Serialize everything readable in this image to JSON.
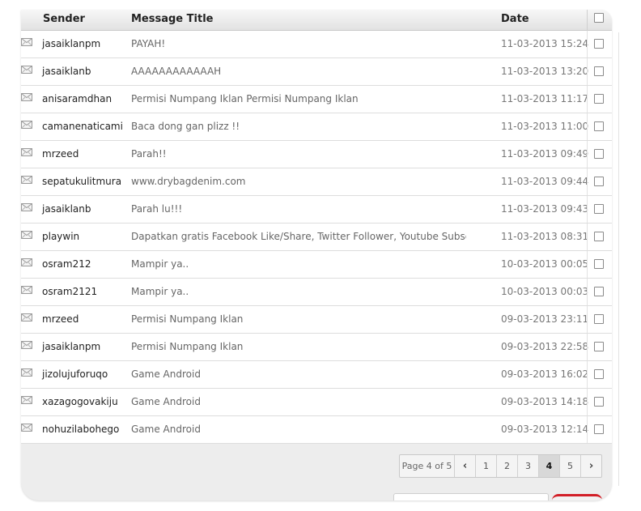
{
  "header": {
    "sender": "Sender",
    "title": "Message Title",
    "date": "Date"
  },
  "messages": [
    {
      "sender": "jasaiklanpm",
      "title": "PAYAH!",
      "date": "11-03-2013 15:24"
    },
    {
      "sender": "jasaiklanb",
      "title": "AAAAAAAAAAAAH",
      "date": "11-03-2013 13:20"
    },
    {
      "sender": "anisaramdhan",
      "title": "Permisi Numpang Iklan Permisi Numpang Iklan",
      "date": "11-03-2013 11:17"
    },
    {
      "sender": "camanenaticami",
      "title": "Baca dong gan plizz !!",
      "date": "11-03-2013 11:00"
    },
    {
      "sender": "mrzeed",
      "title": "Parah!!",
      "date": "11-03-2013 09:49"
    },
    {
      "sender": "sepatukulitmura",
      "title": "www.drybagdenim.com",
      "date": "11-03-2013 09:44"
    },
    {
      "sender": "jasaiklanb",
      "title": "Parah lu!!!",
      "date": "11-03-2013 09:43"
    },
    {
      "sender": "playwin",
      "title": "Dapatkan gratis Facebook Like/Share, Twitter Follower, Youtube Subscribe",
      "date": "11-03-2013 08:31"
    },
    {
      "sender": "osram212",
      "title": "Mampir ya..",
      "date": "10-03-2013 00:05"
    },
    {
      "sender": "osram2121",
      "title": "Mampir ya..",
      "date": "10-03-2013 00:03"
    },
    {
      "sender": "mrzeed",
      "title": "Permisi Numpang Iklan",
      "date": "09-03-2013 23:11"
    },
    {
      "sender": "jasaiklanpm",
      "title": "Permisi Numpang Iklan",
      "date": "09-03-2013 22:58"
    },
    {
      "sender": "jizolujuforuqo",
      "title": "Game Android",
      "date": "09-03-2013 16:02"
    },
    {
      "sender": "xazagogovakiju",
      "title": "Game Android",
      "date": "09-03-2013 14:18"
    },
    {
      "sender": "nohuzilabohego",
      "title": "Game Android",
      "date": "09-03-2013 12:14"
    }
  ],
  "pagination": {
    "info": "Page 4 of 5",
    "prev_icon": "chevron-left-icon",
    "next_icon": "chevron-right-icon",
    "pages": [
      "1",
      "2",
      "3",
      "4",
      "5"
    ],
    "current": "4"
  },
  "icons": {
    "row_icon": "envelope-icon"
  },
  "colors": {
    "accent": "#d21f27",
    "panel_bg": "#ededed",
    "row_border": "#dddddd"
  }
}
